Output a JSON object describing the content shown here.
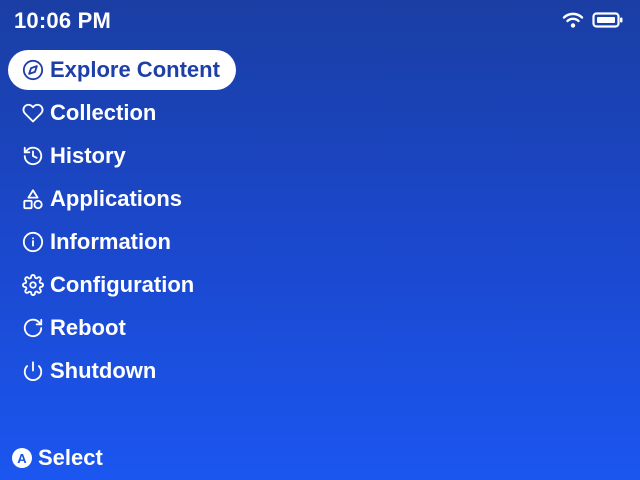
{
  "status": {
    "time": "10:06 PM",
    "icons": [
      "wifi-icon",
      "battery-icon"
    ]
  },
  "menu": {
    "items": [
      {
        "label": "Explore Content",
        "icon": "compass-icon",
        "selected": true
      },
      {
        "label": "Collection",
        "icon": "heart-icon",
        "selected": false
      },
      {
        "label": "History",
        "icon": "history-icon",
        "selected": false
      },
      {
        "label": "Applications",
        "icon": "shapes-icon",
        "selected": false
      },
      {
        "label": "Information",
        "icon": "info-icon",
        "selected": false
      },
      {
        "label": "Configuration",
        "icon": "gear-icon",
        "selected": false
      },
      {
        "label": "Reboot",
        "icon": "refresh-icon",
        "selected": false
      },
      {
        "label": "Shutdown",
        "icon": "power-icon",
        "selected": false
      }
    ]
  },
  "hint": {
    "button": "A",
    "label": "Select"
  },
  "colors": {
    "background_top": "#1a3ea3",
    "background_bottom": "#1b56f0",
    "selected_background": "#ffffff",
    "selected_text": "#1f3fa8"
  }
}
